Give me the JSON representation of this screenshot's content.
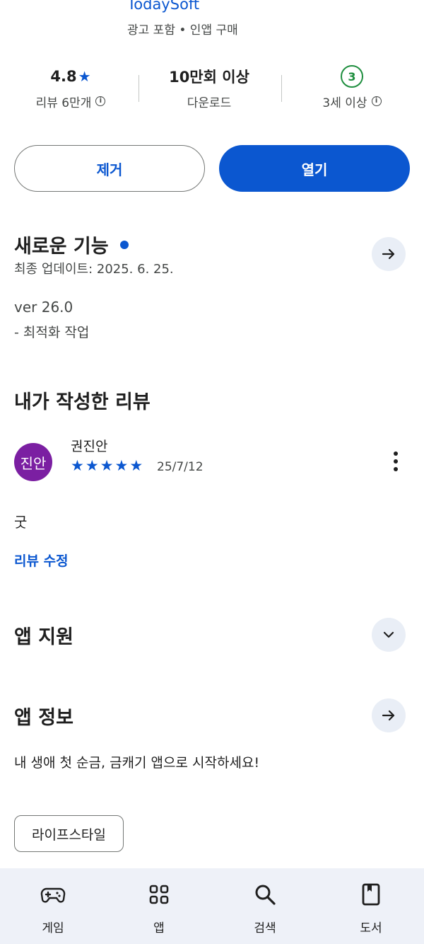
{
  "app": {
    "developer": "TodaySoft",
    "subinfo": "광고 포함 • 인앱 구매"
  },
  "stats": {
    "rating": "4.8",
    "rating_star": "★",
    "reviews_label": "리뷰 6만개",
    "downloads": "10만회 이상",
    "downloads_label": "다운로드",
    "age_badge": "3",
    "age_label": "3세 이상",
    "info_glyph": "i"
  },
  "actions": {
    "remove_label": "제거",
    "open_label": "열기"
  },
  "whats_new": {
    "title": "새로운 기능",
    "updated": "최종 업데이트: 2025. 6. 25.",
    "version": "ver 26.0",
    "notes": "- 최적화 작업"
  },
  "my_review": {
    "title": "내가 작성한 리뷰",
    "avatar_text": "진안",
    "reviewer": "권진안",
    "stars": 5,
    "star_glyph": "★",
    "date": "25/7/12",
    "text": "굿",
    "edit_label": "리뷰 수정"
  },
  "app_support": {
    "title": "앱 지원"
  },
  "app_info": {
    "title": "앱 정보",
    "description": "내 생애 첫 순금, 금캐기 앱으로 시작하세요!",
    "category": "라이프스타일"
  },
  "bottom_nav": {
    "items": [
      {
        "label": "게임",
        "icon": "gamepad-icon"
      },
      {
        "label": "앱",
        "icon": "apps-grid-icon"
      },
      {
        "label": "검색",
        "icon": "search-icon"
      },
      {
        "label": "도서",
        "icon": "book-icon"
      }
    ]
  },
  "colors": {
    "accent": "#0b57d0",
    "age_green": "#1e8e3e",
    "avatar_purple": "#7b1fa2",
    "nav_bg": "#eef1f8"
  }
}
